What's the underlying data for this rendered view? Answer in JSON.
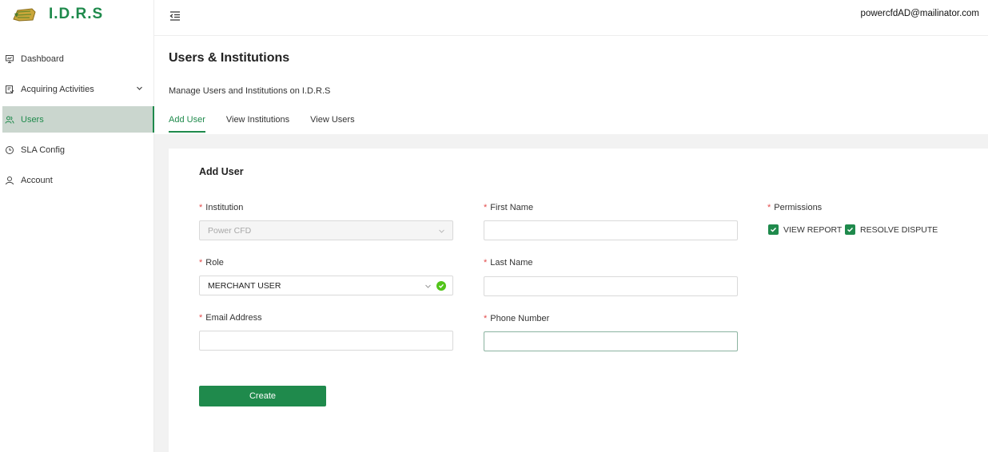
{
  "app": {
    "logo_title": "I.D.R.S"
  },
  "sidebar": {
    "items": [
      {
        "label": "Dashboard",
        "icon": "presentation-icon"
      },
      {
        "label": "Acquiring Activities",
        "icon": "clipboard-icon",
        "has_chevron": true
      },
      {
        "label": "Users",
        "icon": "users-icon",
        "active": true
      },
      {
        "label": "SLA Config",
        "icon": "clock-icon"
      },
      {
        "label": "Account",
        "icon": "user-icon"
      }
    ]
  },
  "header": {
    "user_email": "powercfdAD@mailinator.com"
  },
  "page": {
    "title": "Users & Institutions",
    "description": "Manage Users and Institutions on I.D.R.S",
    "tabs": [
      "Add User",
      "View Institutions",
      "View Users"
    ],
    "active_tab": "Add User"
  },
  "form": {
    "title": "Add User",
    "required_mark": "*",
    "institution": {
      "label": "Institution",
      "value": "Power CFD"
    },
    "role": {
      "label": "Role",
      "value": "MERCHANT USER"
    },
    "email": {
      "label": "Email Address",
      "value": ""
    },
    "first_name": {
      "label": "First Name",
      "value": ""
    },
    "last_name": {
      "label": "Last Name",
      "value": ""
    },
    "phone": {
      "label": "Phone Number",
      "value": ""
    },
    "permissions": {
      "label": "Permissions",
      "options": [
        {
          "label": "VIEW REPORT",
          "checked": true
        },
        {
          "label": "RESOLVE DISPUTE",
          "checked": true
        }
      ]
    },
    "submit_label": "Create"
  },
  "colors": {
    "brand": "#1f8a4c",
    "active_bg": "#cad6ce",
    "required": "#e34b4b",
    "success": "#52c41a"
  }
}
